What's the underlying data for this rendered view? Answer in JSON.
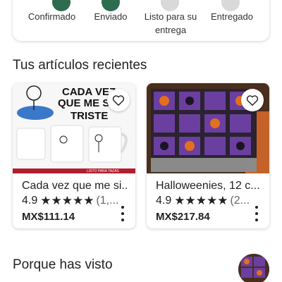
{
  "tracking": {
    "steps": [
      {
        "label": "Confirmado"
      },
      {
        "label": "Enviado"
      },
      {
        "label": "Listo para su\nentrega"
      },
      {
        "label": "Entregado"
      }
    ]
  },
  "sections": {
    "recent_title": "Tus artículos recientes",
    "because_title": "Porque has visto"
  },
  "products": [
    {
      "title": "Cada vez que me si...",
      "rating": "4.9",
      "stars": "★★★★★",
      "count": "(1,...",
      "price": "MX$111.14",
      "image_text_1": "CADA VEZ",
      "image_text_2": "QUE ME SIE",
      "image_text_3": "TRISTE",
      "image_footer": "LISTO PARA TAZAS"
    },
    {
      "title": "Halloweenies, 12 c...",
      "rating": "4.9",
      "stars": "★★★★★",
      "count": "(2...",
      "price": "MX$217.84"
    }
  ],
  "colors": {
    "green_step": "#2e6b4f",
    "gray_step": "#d9d9d9",
    "accent_red": "#b01e2f",
    "purple": "#6b3fa0",
    "orange": "#e2701f"
  }
}
